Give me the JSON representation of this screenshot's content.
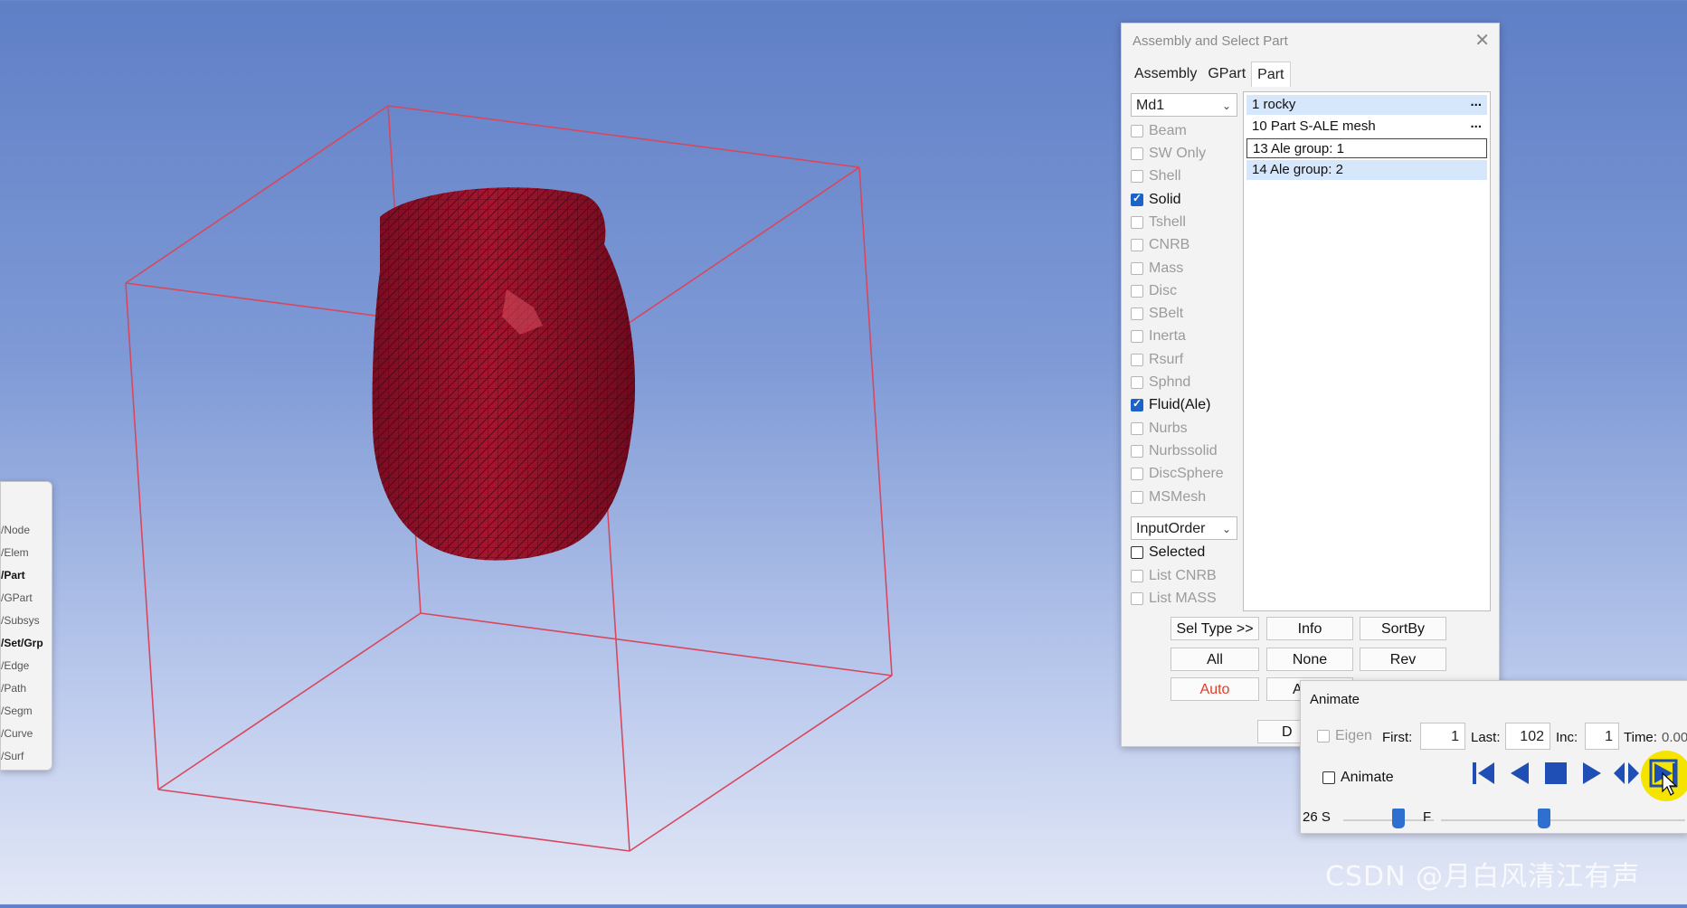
{
  "side_strip": {
    "items": [
      {
        "label": "/Node",
        "bold": false
      },
      {
        "label": "/Elem",
        "bold": false
      },
      {
        "label": "/Part",
        "bold": true
      },
      {
        "label": "/GPart",
        "bold": false
      },
      {
        "label": "/Subsys",
        "bold": false
      },
      {
        "label": "/Set/Grp",
        "bold": true
      },
      {
        "label": "/Edge",
        "bold": false
      },
      {
        "label": "/Path",
        "bold": false
      },
      {
        "label": "/Segm",
        "bold": false
      },
      {
        "label": "/Curve",
        "bold": false
      },
      {
        "label": "/Surf",
        "bold": false
      }
    ]
  },
  "assembly_dialog": {
    "title": "Assembly and Select Part",
    "close_glyph": "✕",
    "tabs": [
      "Assembly",
      "GPart",
      "Part"
    ],
    "active_tab": "Part",
    "model_select": "Md1",
    "element_types": [
      {
        "label": "Beam",
        "checked": false
      },
      {
        "label": "SW Only",
        "checked": false
      },
      {
        "label": "Shell",
        "checked": false
      },
      {
        "label": "Solid",
        "checked": true
      },
      {
        "label": "Tshell",
        "checked": false
      },
      {
        "label": "CNRB",
        "checked": false
      },
      {
        "label": "Mass",
        "checked": false
      },
      {
        "label": "Disc",
        "checked": false
      },
      {
        "label": "SBelt",
        "checked": false
      },
      {
        "label": "Inerta",
        "checked": false
      },
      {
        "label": "Rsurf",
        "checked": false
      },
      {
        "label": "Sphnd",
        "checked": false
      },
      {
        "label": "Fluid(Ale)",
        "checked": true
      },
      {
        "label": "Nurbs",
        "checked": false
      },
      {
        "label": "Nurbssolid",
        "checked": false
      },
      {
        "label": "DiscSphere",
        "checked": false
      },
      {
        "label": "MSMesh",
        "checked": false
      }
    ],
    "order_select": "InputOrder",
    "options": [
      {
        "label": "Selected",
        "checked": false,
        "enabled": true
      },
      {
        "label": "List CNRB",
        "checked": false,
        "enabled": false
      },
      {
        "label": "List MASS",
        "checked": false,
        "enabled": false
      }
    ],
    "parts": [
      {
        "label": "1 rocky",
        "highlight": true,
        "outline": false,
        "dots": "..."
      },
      {
        "label": "10 Part S-ALE mesh",
        "highlight": false,
        "outline": false,
        "dots": "..."
      },
      {
        "label": "13 Ale group: 1",
        "highlight": false,
        "outline": true,
        "dots": ""
      },
      {
        "label": "14 Ale group: 2",
        "highlight": true,
        "outline": false,
        "dots": ""
      }
    ],
    "buttons": {
      "sel_type": "Sel Type >>",
      "info": "Info",
      "sortby": "SortBy",
      "all": "All",
      "none": "None",
      "rev": "Rev",
      "auto": "Auto",
      "partial_a": "A",
      "partial_d": "D"
    }
  },
  "animate_panel": {
    "title": "Animate",
    "eigen_label": "Eigen",
    "first_label": "First:",
    "first_value": "1",
    "last_label": "Last:",
    "last_value": "102",
    "inc_label": "Inc:",
    "inc_value": "1",
    "time_label": "Time:",
    "time_value": "0.00",
    "animate_label": "Animate",
    "speed_label": "26 S",
    "frame_label": "F",
    "controls": [
      "skip-to-start",
      "step-back",
      "stop",
      "play-forward",
      "bounce",
      "play-loop"
    ]
  },
  "watermark": "CSDN @月白风清江有声",
  "colors": {
    "mesh_fill": "#8e1028",
    "box_edge": "#d7485e",
    "selection_blue": "#1b63c8",
    "auto_red": "#e53a2a",
    "control_blue": "#1f4fb5"
  }
}
